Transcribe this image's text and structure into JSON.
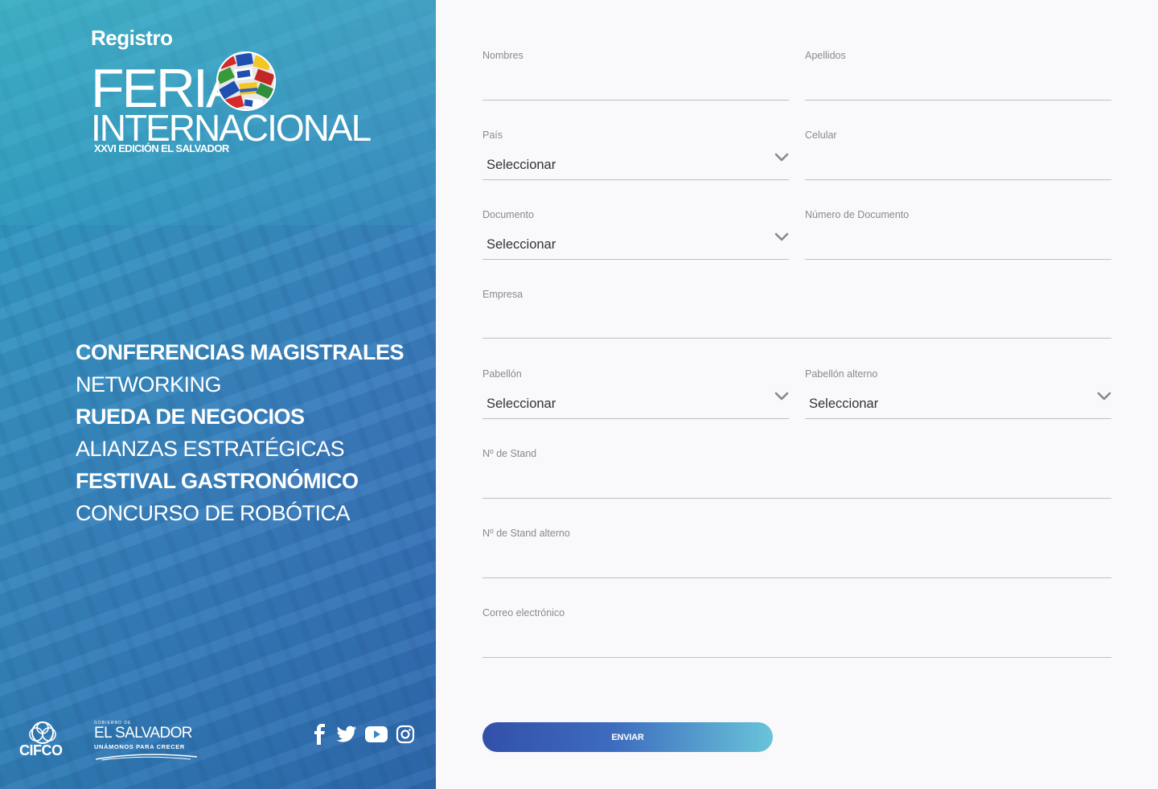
{
  "hero": {
    "registro": "Registro",
    "logo": {
      "line1": "FERIA",
      "line2": "INTERNACIONAL",
      "line3": "XXVI EDICIÓN EL SALVADOR"
    },
    "features": [
      {
        "label": "CONFERENCIAS MAGISTRALES",
        "weight": "bold"
      },
      {
        "label": "NETWORKING",
        "weight": "light"
      },
      {
        "label": "RUEDA DE NEGOCIOS",
        "weight": "bold"
      },
      {
        "label": "ALIANZAS ESTRATÉGICAS",
        "weight": "light"
      },
      {
        "label": "FESTIVAL GASTRONÓMICO",
        "weight": "bold"
      },
      {
        "label": "CONCURSO DE ROBÓTICA",
        "weight": "light"
      }
    ],
    "footer": {
      "cifco": "CIFCO",
      "gob_small": "GOBIERNO DE",
      "gob_big": "EL SALVADOR",
      "gob_tag": "UNÁMONOS PARA CRECER"
    },
    "social": [
      "facebook-icon",
      "twitter-icon",
      "youtube-icon",
      "instagram-icon"
    ]
  },
  "form": {
    "nombres": {
      "label": "Nombres",
      "value": ""
    },
    "apellidos": {
      "label": "Apellidos",
      "value": ""
    },
    "pais": {
      "label": "País",
      "value": "Seleccionar"
    },
    "celular": {
      "label": "Celular",
      "value": ""
    },
    "documento": {
      "label": "Documento",
      "value": "Seleccionar"
    },
    "numero_documento": {
      "label": "Número de Documento",
      "value": ""
    },
    "empresa": {
      "label": "Empresa",
      "value": ""
    },
    "pabellon": {
      "label": "Pabellón",
      "value": "Seleccionar"
    },
    "pabellon_alterno": {
      "label": "Pabellón alterno",
      "value": "Seleccionar"
    },
    "stand": {
      "label": "Nº de Stand",
      "value": ""
    },
    "stand_alterno": {
      "label": "Nº de Stand alterno",
      "value": ""
    },
    "correo": {
      "label": "Correo electrónico",
      "value": ""
    },
    "submit": "ENVIAR"
  },
  "colors": {
    "accent_start": "#3350a8",
    "accent_end": "#69c4d9",
    "hero_blue": "#3f7fc0",
    "label_gray": "#8a8a8a"
  }
}
